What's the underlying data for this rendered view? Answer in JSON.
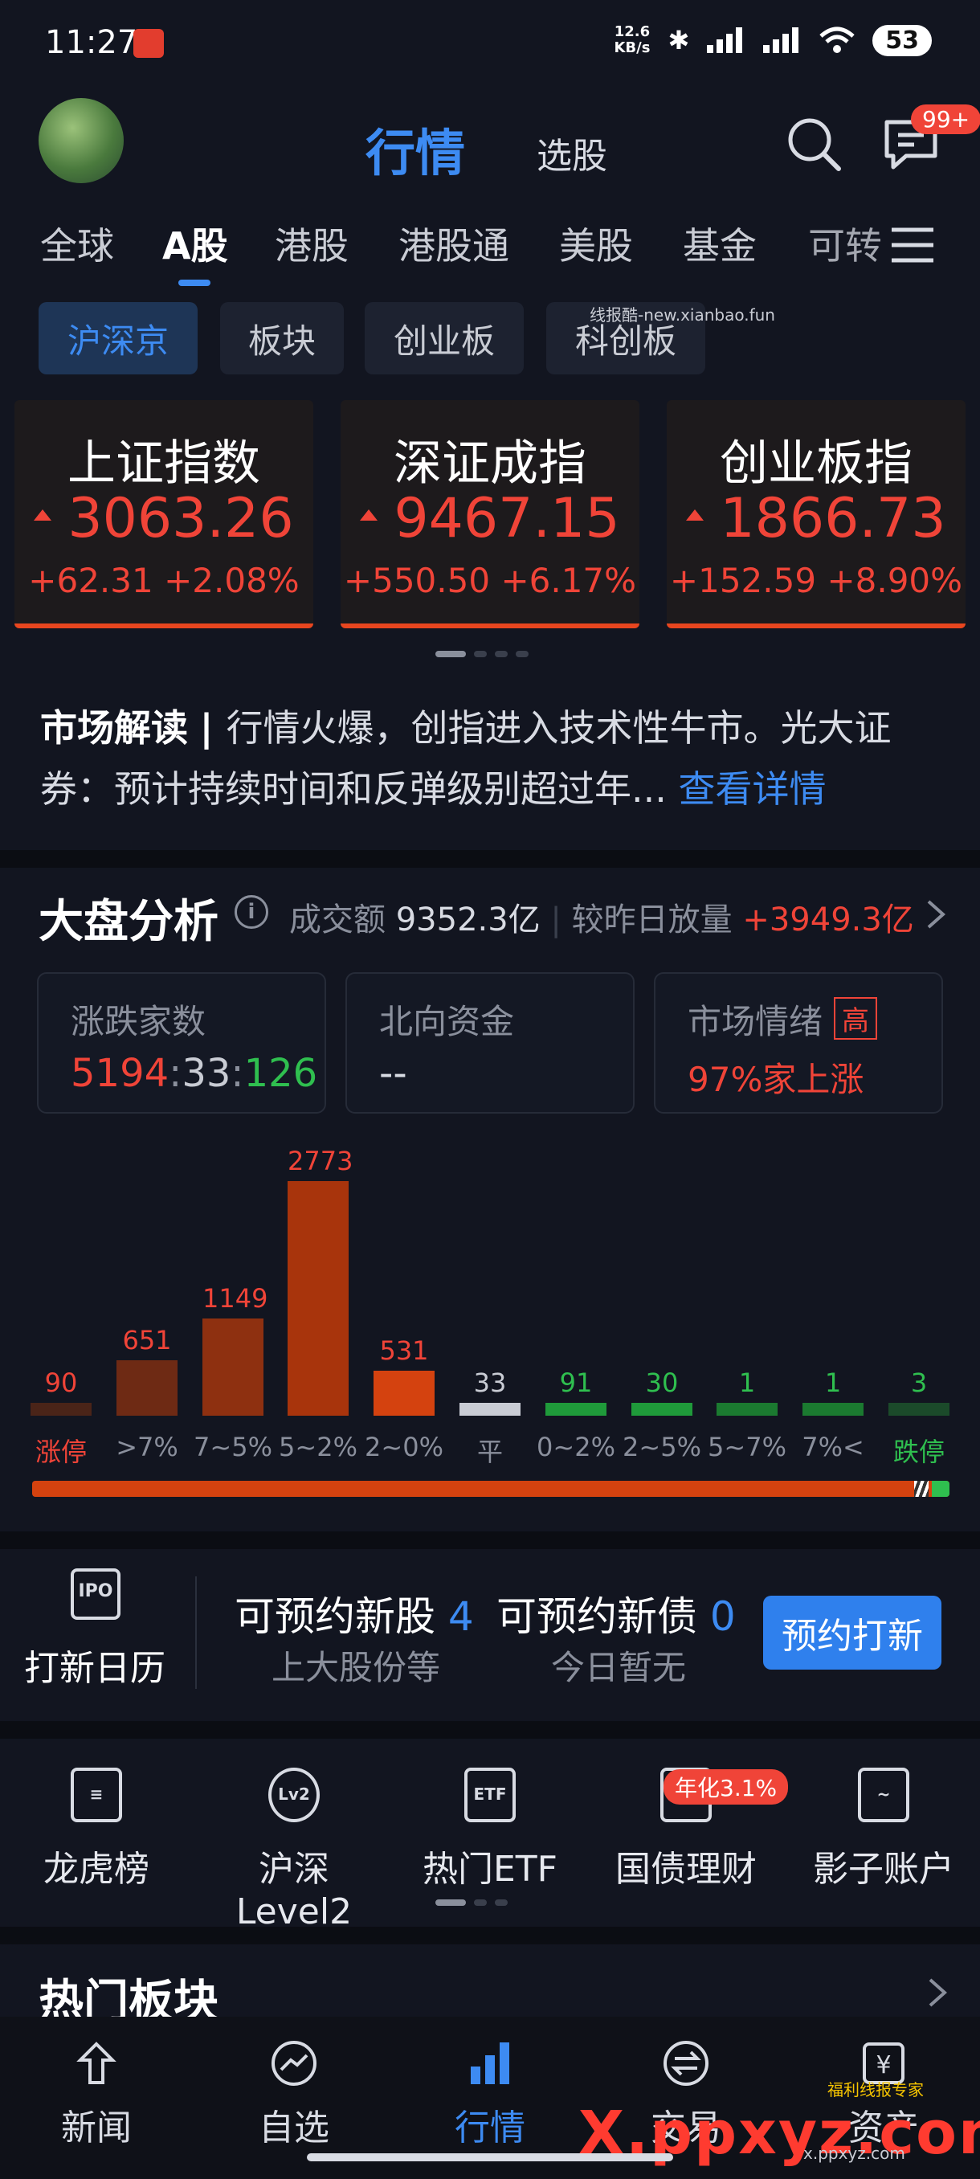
{
  "status_bar": {
    "time": "11:27",
    "net_speed_value": "12.6",
    "net_speed_unit": "KB/s",
    "battery": "53"
  },
  "header": {
    "title": "行情",
    "subtitle": "选股",
    "msg_badge": "99+"
  },
  "market_tabs": [
    "全球",
    "A股",
    "港股",
    "港股通",
    "美股",
    "基金",
    "可转"
  ],
  "sub_tabs": [
    "沪深京",
    "板块",
    "创业板",
    "科创板"
  ],
  "watermark": "线报酷-new.xianbao.fun",
  "indices": [
    {
      "name": "上证指数",
      "value": "3063.26",
      "change": "+62.31",
      "percent": "+2.08%"
    },
    {
      "name": "深证成指",
      "value": "9467.15",
      "change": "+550.50",
      "percent": "+6.17%"
    },
    {
      "name": "创业板指",
      "value": "1866.73",
      "change": "+152.59",
      "percent": "+8.90%"
    }
  ],
  "commentary": {
    "label": "市场解读",
    "text": "行情火爆，创指进入技术性牛市。光大证券：预计持续时间和反弹级别超过年...",
    "link": "查看详情"
  },
  "analysis": {
    "title": "大盘分析",
    "turnover_label": "成交额",
    "turnover_value": "9352.3亿",
    "volume_label": "较昨日放量",
    "volume_value": "+3949.3亿",
    "boxes": {
      "updown_label": "涨跌家数",
      "up": "5194",
      "flat": "33",
      "down": "126",
      "north_label": "北向资金",
      "north_value": "--",
      "sentiment_label": "市场情绪",
      "sentiment_tag": "高",
      "sentiment_value": "97%家上涨"
    }
  },
  "chart_data": {
    "type": "bar",
    "categories": [
      "涨停",
      ">7%",
      "7~5%",
      "5~2%",
      "2~0%",
      "平",
      "0~2%",
      "2~5%",
      "5~7%",
      "7%<",
      "跌停"
    ],
    "values": [
      90,
      651,
      1149,
      2773,
      531,
      33,
      91,
      30,
      1,
      1,
      3
    ],
    "colors": [
      "#4a2418",
      "#6e2a14",
      "#8e3010",
      "#a8340c",
      "#d4420f",
      "#c9ccd4",
      "#1f9a3a",
      "#1f9a3a",
      "#1b7a30",
      "#1b7a30",
      "#1b4a2a"
    ],
    "label_colors": [
      "#f04438",
      "#8a8f9c",
      "#8a8f9c",
      "#8a8f9c",
      "#8a8f9c",
      "#8a8f9c",
      "#8a8f9c",
      "#8a8f9c",
      "#8a8f9c",
      "#8a8f9c",
      "#2fbf4f"
    ],
    "number_colors": [
      "#f04438",
      "#f04438",
      "#f04438",
      "#f04438",
      "#f04438",
      "#c9ccd4",
      "#2fbf4f",
      "#2fbf4f",
      "#2fbf4f",
      "#2fbf4f",
      "#2fbf4f"
    ]
  },
  "ipo": {
    "calendar_label": "打新日历",
    "stock_label": "可预约新股",
    "stock_count": "4",
    "stock_sub": "上大股份等",
    "bond_label": "可预约新债",
    "bond_count": "0",
    "bond_sub": "今日暂无",
    "button": "预约打新"
  },
  "tools": [
    {
      "label": "龙虎榜",
      "icon": "list-doc-icon"
    },
    {
      "label": "沪深Level2",
      "icon": "lv2-icon"
    },
    {
      "label": "热门ETF",
      "icon": "etf-icon"
    },
    {
      "label": "国债理财",
      "icon": "bond-icon"
    },
    {
      "label": "影子账户",
      "icon": "chart-card-icon"
    }
  ],
  "yield_badge": "年化3.1%",
  "hot_sectors": {
    "title": "热门板块"
  },
  "bottom_nav": [
    "新闻",
    "自选",
    "行情",
    "交易",
    "资产"
  ],
  "overlay": {
    "logo": "X.ppxyz.com",
    "logo_sub": "福利线报专家",
    "url": "x.ppxyz.com"
  },
  "colors": {
    "accent": "#3d8bf2",
    "up": "#f04438",
    "down": "#2fbf4f",
    "background": "#121520"
  }
}
